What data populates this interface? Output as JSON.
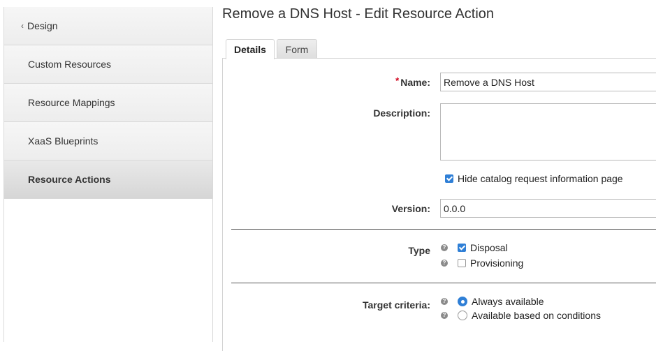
{
  "sidebar": {
    "back_label": "Design",
    "items": [
      {
        "label": "Custom Resources"
      },
      {
        "label": "Resource Mappings"
      },
      {
        "label": "XaaS Blueprints"
      },
      {
        "label": "Resource Actions",
        "active": true
      }
    ]
  },
  "page": {
    "title": "Remove a DNS Host - Edit Resource Action"
  },
  "tabs": [
    {
      "label": "Details",
      "active": true
    },
    {
      "label": "Form"
    }
  ],
  "form": {
    "name_required_mark": "*",
    "name_label": "Name:",
    "name_value": "Remove a DNS Host",
    "description_label": "Description:",
    "description_value": "",
    "hide_catalog_label": "Hide catalog request information page",
    "hide_catalog_checked": true,
    "version_label": "Version:",
    "version_value": "0.0.0",
    "type_label": "Type",
    "type_options": [
      {
        "label": "Disposal",
        "checked": true
      },
      {
        "label": "Provisioning",
        "checked": false
      }
    ],
    "target_label": "Target criteria:",
    "target_options": [
      {
        "label": "Always available",
        "selected": true
      },
      {
        "label": "Available based on conditions",
        "selected": false
      }
    ],
    "help_glyph": "?"
  },
  "colors": {
    "accent": "#2f7fd6",
    "required": "#d0021b"
  }
}
